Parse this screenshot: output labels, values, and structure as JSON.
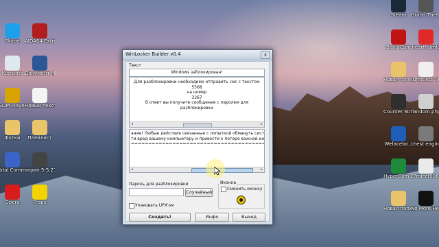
{
  "desktop": {
    "left_icons": [
      {
        "label": "Skype",
        "color": "#1ea0e8"
      },
      {
        "label": "AIDA64 Extre...",
        "color": "#b21e1e"
      },
      {
        "label": "Корзина",
        "color": "#dfe7ef"
      },
      {
        "label": "Документ Microsoft...",
        "color": "#2b5797"
      },
      {
        "label": "GOM Player",
        "color": "#d6a300"
      },
      {
        "label": "Новый текстов...",
        "color": "#f4f4f4"
      },
      {
        "label": "Фотки",
        "color": "#e9c46a"
      },
      {
        "label": "Плейлист",
        "color": "#e9c46a"
      },
      {
        "label": "Total Commander",
        "color": "#3a64c8"
      },
      {
        "label": "скрин 5-5.21",
        "color": "#444"
      },
      {
        "label": "Opera",
        "color": "#d81b1b"
      },
      {
        "label": "Fraps",
        "color": "#f3d400"
      }
    ],
    "right_icons": [
      {
        "label": "Steam",
        "color": "#1b2838"
      },
      {
        "label": "Grand Theft Auto San...",
        "color": "#555"
      },
      {
        "label": "BandiCam",
        "color": "#c01414"
      },
      {
        "label": "heart_aimlo",
        "color": "#e02a2a"
      },
      {
        "label": "Новая папка",
        "color": "#e9c46a"
      },
      {
        "label": "Untitled 79",
        "color": "#efefef"
      },
      {
        "label": "Counter Strike Sou...",
        "color": "#2f2f2f"
      },
      {
        "label": "random.php",
        "color": "#cfcfcf"
      },
      {
        "label": "Wefacebo...",
        "color": "#1e5eb8"
      },
      {
        "label": "chest engine",
        "color": "#7a7a7a"
      },
      {
        "label": "HyperCam 2",
        "color": "#1e8a3c"
      },
      {
        "label": "Project006",
        "color": "#eaeaea"
      },
      {
        "label": "Новая папка",
        "color": "#e9c46a"
      },
      {
        "label": "No More Heroes",
        "color": "#111"
      }
    ]
  },
  "window": {
    "title": "WinLocker Builder v0.4",
    "close_label": "x",
    "text_section_label": "Текст",
    "header_text": "Windows заблокирован!",
    "message_lines": [
      "Для разблокировки необходимо отправить смс с текстом",
      "5568",
      "на номер",
      "3367",
      "В ответ вы получите сообщение с паролем для разблокировки"
    ],
    "warning_lines": [
      "ание! Любые действия связанные с попыткой обмануть систему могут",
      "ти вред вашему компьютеру и привести к потере важной информации.",
      "=============================================="
    ],
    "password_label": "Пароль для разблокировки",
    "password_value": "",
    "random_button": "Случайный",
    "icon_group_label": "Иконка",
    "change_icon_label": "Сменить иконку",
    "upx_label": "Упаковать UPX'ом",
    "create_button": "Создать!",
    "info_button": "Инфо",
    "exit_button": "Выход"
  }
}
